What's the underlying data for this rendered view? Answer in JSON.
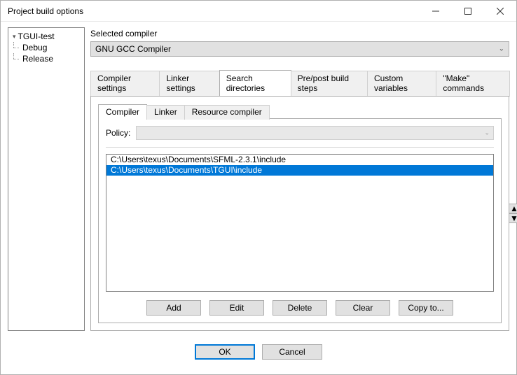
{
  "window": {
    "title": "Project build options"
  },
  "tree": {
    "root": "TGUI-test",
    "children": [
      "Debug",
      "Release"
    ]
  },
  "compiler": {
    "label": "Selected compiler",
    "value": "GNU GCC Compiler"
  },
  "tabs": {
    "items": [
      "Compiler settings",
      "Linker settings",
      "Search directories",
      "Pre/post build steps",
      "Custom variables",
      "\"Make\" commands"
    ],
    "active_index": 2
  },
  "subtabs": {
    "items": [
      "Compiler",
      "Linker",
      "Resource compiler"
    ],
    "active_index": 0
  },
  "policy": {
    "label": "Policy:"
  },
  "list": {
    "items": [
      "C:\\Users\\texus\\Documents\\SFML-2.3.1\\include",
      "C:\\Users\\texus\\Documents\\TGUI\\include"
    ],
    "selected_index": 1
  },
  "buttons": {
    "add": "Add",
    "edit": "Edit",
    "delete": "Delete",
    "clear": "Clear",
    "copyto": "Copy to..."
  },
  "footer": {
    "ok": "OK",
    "cancel": "Cancel"
  }
}
